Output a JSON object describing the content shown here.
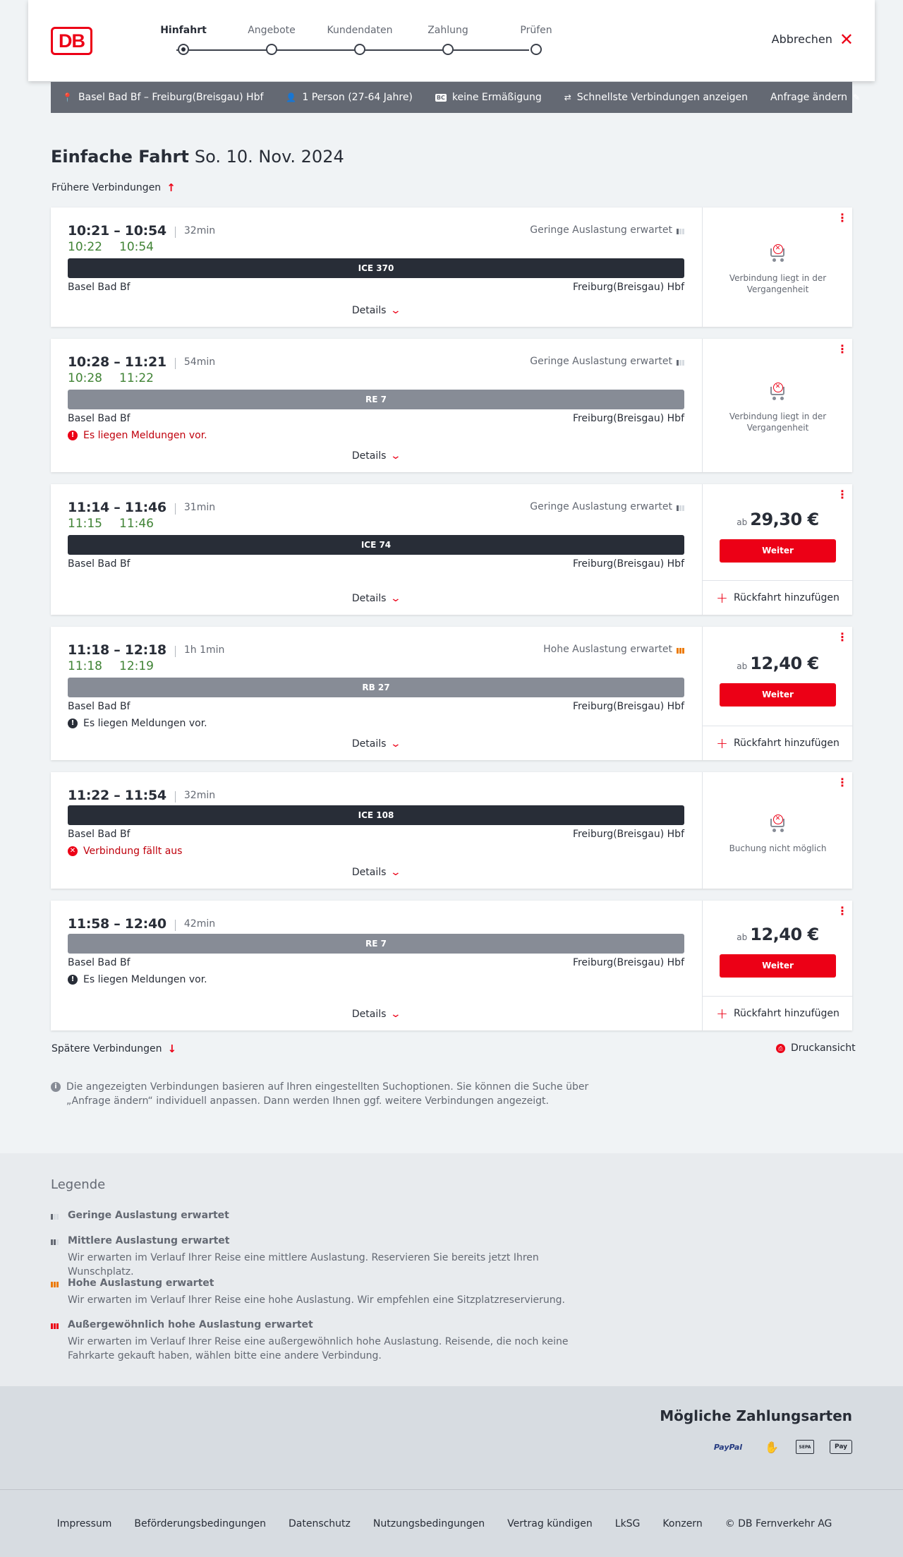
{
  "header": {
    "logo": "DB",
    "steps": [
      {
        "label": "Hinfahrt",
        "active": true
      },
      {
        "label": "Angebote",
        "active": false
      },
      {
        "label": "Kundendaten",
        "active": false
      },
      {
        "label": "Zahlung",
        "active": false
      },
      {
        "label": "Prüfen",
        "active": false
      }
    ],
    "cancel_label": "Abbrechen"
  },
  "search": {
    "route": "Basel Bad Bf – Freiburg(Breisgau) Hbf",
    "passengers": "1 Person (27-64 Jahre)",
    "discount_badge": "BC",
    "discount": "keine Ermäßigung",
    "fastest": "Schnellste Verbindungen anzeigen",
    "change": "Anfrage ändern"
  },
  "title": {
    "type": "Einfache Fahrt",
    "date": "So. 10. Nov. 2024"
  },
  "earlier_label": "Frühere Verbindungen",
  "later_label": "Spätere Verbindungen",
  "print_label": "Druckansicht",
  "connections": [
    {
      "times": "10:21 – 10:54",
      "duration": "32min",
      "real_dep": "10:22",
      "real_arr": "10:54",
      "load": "Geringe Auslastung erwartet",
      "train": "ICE 370",
      "from": "Basel Bad Bf",
      "to": "Freiburg(Breisgau) Hbf",
      "details": "Details",
      "status": "Verbindung liegt in der Vergangenheit"
    },
    {
      "times": "10:28 – 11:21",
      "duration": "54min",
      "real_dep": "10:28",
      "real_arr": "11:22",
      "load": "Geringe Auslastung erwartet",
      "train": "RE 7",
      "from": "Basel Bad Bf",
      "to": "Freiburg(Breisgau) Hbf",
      "message": "Es liegen Meldungen vor.",
      "details": "Details",
      "status": "Verbindung liegt in der Vergangenheit"
    },
    {
      "times": "11:14 – 11:46",
      "duration": "31min",
      "real_dep": "11:15",
      "real_arr": "11:46",
      "load": "Geringe Auslastung erwartet",
      "train": "ICE 74",
      "from": "Basel Bad Bf",
      "to": "Freiburg(Breisgau) Hbf",
      "details": "Details",
      "price_prefix": "ab",
      "price": "29,30 €",
      "button": "Weiter",
      "return": "Rückfahrt hinzufügen"
    },
    {
      "times": "11:18 – 12:18",
      "duration": "1h 1min",
      "real_dep": "11:18",
      "real_arr": "12:19",
      "load": "Hohe Auslastung erwartet",
      "train": "RB 27",
      "from": "Basel Bad Bf",
      "to": "Freiburg(Breisgau) Hbf",
      "message": "Es liegen Meldungen vor.",
      "details": "Details",
      "price_prefix": "ab",
      "price": "12,40 €",
      "button": "Weiter",
      "return": "Rückfahrt hinzufügen"
    },
    {
      "times": "11:22 – 11:54",
      "duration": "32min",
      "train": "ICE 108",
      "from": "Basel Bad Bf",
      "to": "Freiburg(Breisgau) Hbf",
      "message": "Verbindung fällt aus",
      "details": "Details",
      "status": "Buchung nicht möglich"
    },
    {
      "times": "11:58 – 12:40",
      "duration": "42min",
      "train": "RE 7",
      "from": "Basel Bad Bf",
      "to": "Freiburg(Breisgau) Hbf",
      "message": "Es liegen Meldungen vor.",
      "details": "Details",
      "price_prefix": "ab",
      "price": "12,40 €",
      "button": "Weiter",
      "return": "Rückfahrt hinzufügen"
    }
  ],
  "info_text": "Die angezeigten Verbindungen basieren auf Ihren eingestellten Suchoptionen. Sie können die Suche über „Anfrage ändern“ individuell anpassen. Dann werden Ihnen ggf. weitere Verbindungen angezeigt.",
  "legend": {
    "title": "Legende",
    "items": [
      {
        "title": "Geringe Auslastung erwartet",
        "desc": ""
      },
      {
        "title": "Mittlere Auslastung erwartet",
        "desc": "Wir erwarten im Verlauf Ihrer Reise eine mittlere Auslastung. Reservieren Sie bereits jetzt Ihren Wunschplatz."
      },
      {
        "title": "Hohe Auslastung erwartet",
        "desc": "Wir erwarten im Verlauf Ihrer Reise eine hohe Auslastung. Wir empfehlen eine Sitzplatzreservierung."
      },
      {
        "title": "Außergewöhnlich hohe Auslastung erwartet",
        "desc": "Wir erwarten im Verlauf Ihrer Reise eine außergewöhnlich hohe Auslastung. Reisende, die noch keine Fahrkarte gekauft haben, wählen bitte eine andere Verbindung."
      }
    ]
  },
  "payment": {
    "title": "Mögliche Zahlungsarten",
    "paypal": "PayPal",
    "sepa": "SEPA",
    "applepay": "Pay"
  },
  "footer": {
    "links": [
      "Impressum",
      "Beförderungsbedingungen",
      "Datenschutz",
      "Nutzungsbedingungen",
      "Vertrag kündigen",
      "LkSG",
      "Konzern"
    ],
    "copyright": "© DB Fernverkehr AG"
  },
  "colors": {
    "brand_red": "#ec0016",
    "realtime_green": "#408335",
    "searchbar_gray": "#646973",
    "high_load_orange": "#ec7a00"
  }
}
